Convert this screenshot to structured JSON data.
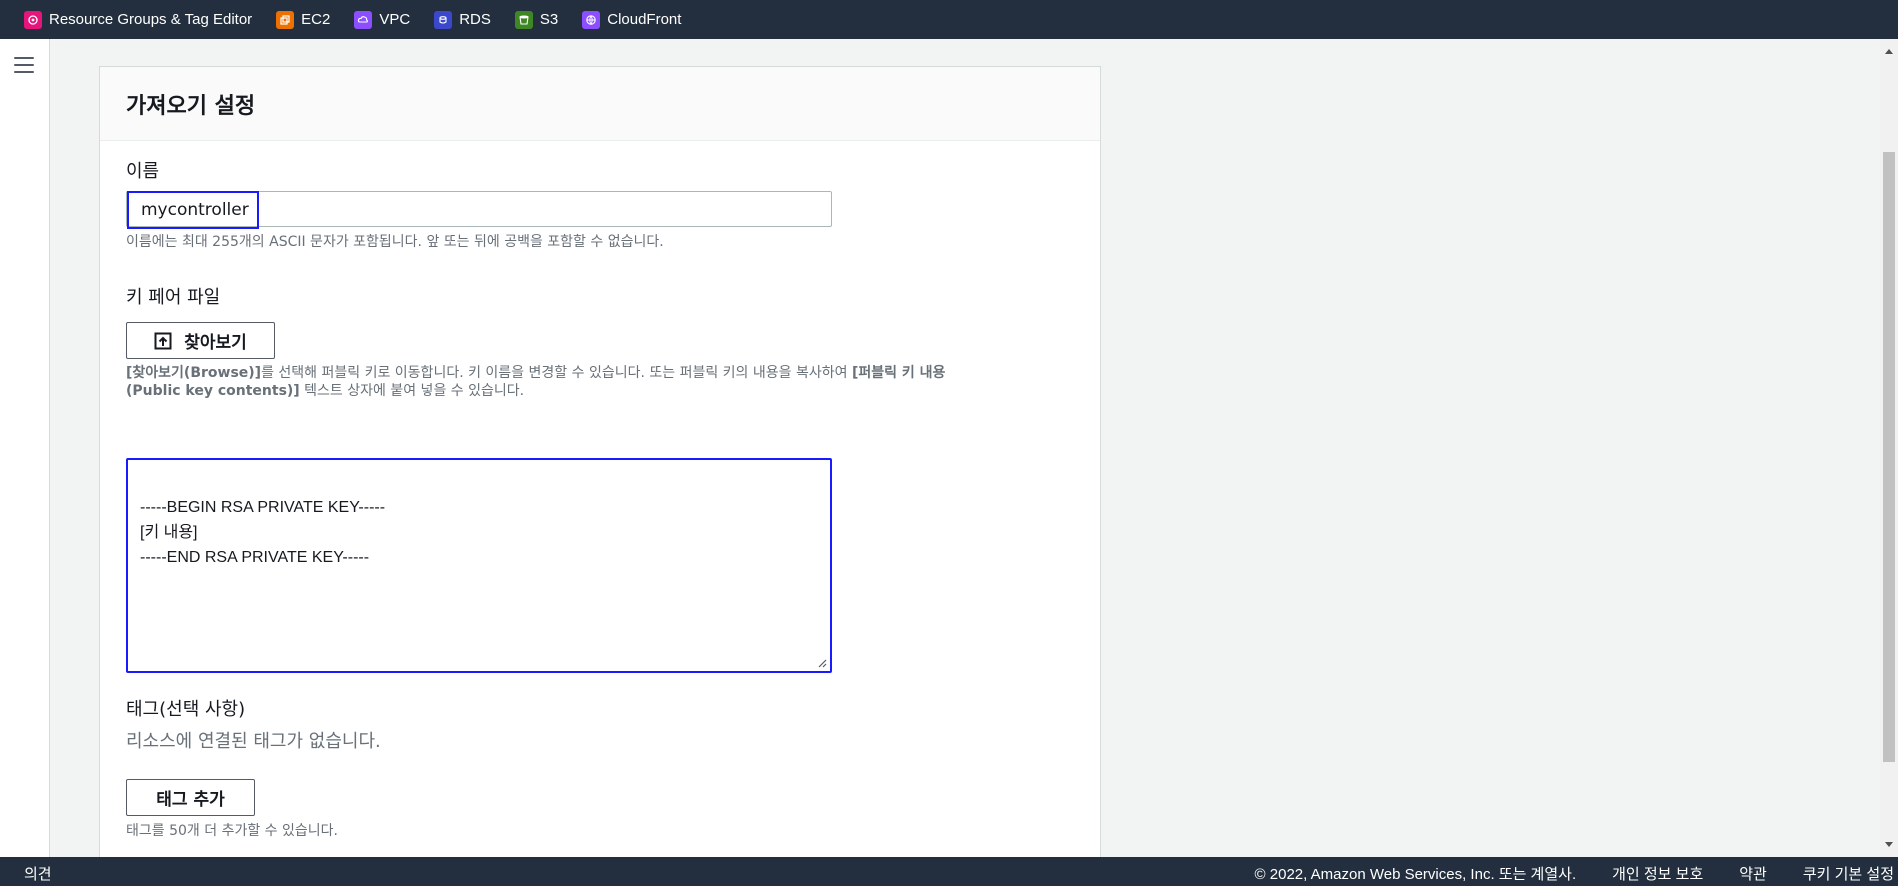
{
  "favorites": [
    {
      "label": "Resource Groups & Tag Editor",
      "icon": "resource-groups-icon",
      "color": "#e7157b"
    },
    {
      "label": "EC2",
      "icon": "ec2-icon",
      "color": "#ed7100"
    },
    {
      "label": "VPC",
      "icon": "vpc-icon",
      "color": "#8c4fff"
    },
    {
      "label": "RDS",
      "icon": "rds-icon",
      "color": "#3b48cc"
    },
    {
      "label": "S3",
      "icon": "s3-icon",
      "color": "#3f8624"
    },
    {
      "label": "CloudFront",
      "icon": "cloudfront-icon",
      "color": "#8c4fff"
    }
  ],
  "panel": {
    "title": "가져오기 설정",
    "name": {
      "label": "이름",
      "value": "mycontroller",
      "hint": "이름에는 최대 255개의 ASCII 문자가 포함됩니다. 앞 또는 뒤에 공백을 포함할 수 없습니다."
    },
    "keyfile": {
      "label": "키 페어 파일",
      "browse_label": "찾아보기",
      "hint_part1": "[찾아보기(Browse)]",
      "hint_part2": "를 선택해 퍼블릭 키로 이동합니다. 키 이름을 변경할 수 있습니다. 또는 퍼블릭 키의 내용을 복사하여 ",
      "hint_part3": "[퍼블릭 키 내용",
      "hint_part4": "(Public key contents)]",
      "hint_part5": " 텍스트 상자에 붙여 넣을 수 있습니다.",
      "contents": "-----BEGIN RSA PRIVATE KEY-----\n[키 내용]\n-----END RSA PRIVATE KEY-----"
    },
    "tags": {
      "label": "태그(선택 사항)",
      "empty_text": "리소스에 연결된 태그가 없습니다.",
      "add_label": "태그 추가",
      "hint": "태그를 50개 더 추가할 수 있습니다."
    }
  },
  "footer": {
    "feedback": "의견",
    "copyright": "© 2022, Amazon Web Services, Inc. 또는 계열사.",
    "privacy": "개인 정보 보호",
    "terms": "약관",
    "cookies": "쿠키 기본 설정"
  },
  "colors": {
    "nav_bg": "#232f3e",
    "focus_border": "#1a1aff",
    "hint_text": "#687078"
  }
}
